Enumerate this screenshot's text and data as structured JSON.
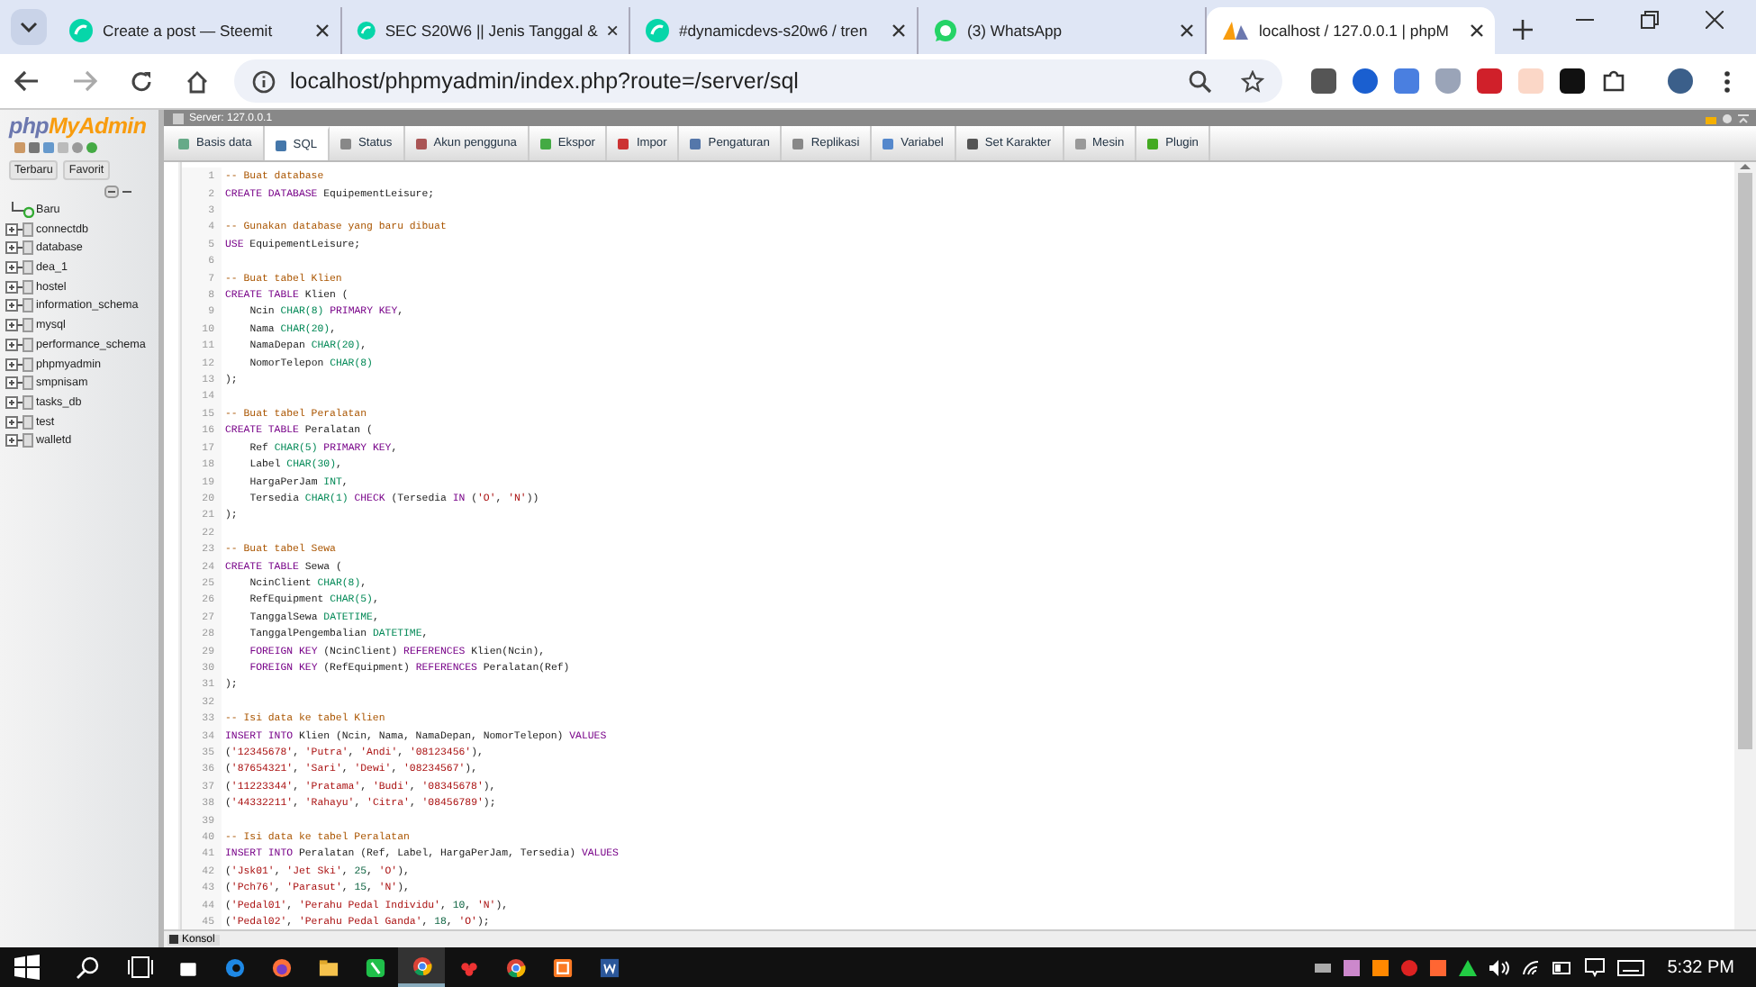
{
  "browser": {
    "tabs": [
      {
        "title": "Create a post — Steemit",
        "selected": false,
        "kind": "steemit"
      },
      {
        "title": "SEC S20W6 || Jenis Tanggal &",
        "selected": false,
        "kind": "steemit"
      },
      {
        "title": "#dynamicdevs-s20w6 / tren",
        "selected": false,
        "kind": "steemit"
      },
      {
        "title": "(3) WhatsApp",
        "selected": false,
        "kind": "whatsapp"
      },
      {
        "title": "localhost / 127.0.0.1 | phpM",
        "selected": true,
        "kind": "pma"
      }
    ],
    "address": "localhost/phpmyadmin/index.php?route=/server/sql"
  },
  "sidebar": {
    "logo": [
      "php",
      "MyAdmin"
    ],
    "buttons": [
      {
        "label": "Terbaru"
      },
      {
        "label": "Favorit"
      }
    ],
    "tree": [
      {
        "name": "Baru",
        "kind": "new"
      },
      {
        "name": "connectdb",
        "kind": "db"
      },
      {
        "name": "database",
        "kind": "db"
      },
      {
        "name": "dea_1",
        "kind": "db"
      },
      {
        "name": "hostel",
        "kind": "db"
      },
      {
        "name": "information_schema",
        "kind": "db"
      },
      {
        "name": "mysql",
        "kind": "db"
      },
      {
        "name": "performance_schema",
        "kind": "db"
      },
      {
        "name": "phpmyadmin",
        "kind": "db"
      },
      {
        "name": "smpnisam",
        "kind": "db"
      },
      {
        "name": "tasks_db",
        "kind": "db"
      },
      {
        "name": "test",
        "kind": "db"
      },
      {
        "name": "walletd",
        "kind": "db"
      }
    ]
  },
  "breadcrumb": "Server: 127.0.0.1",
  "menu": [
    {
      "label": "Basis data",
      "selected": false
    },
    {
      "label": "SQL",
      "selected": true
    },
    {
      "label": "Status",
      "selected": false
    },
    {
      "label": "Akun pengguna",
      "selected": false
    },
    {
      "label": "Ekspor",
      "selected": false
    },
    {
      "label": "Impor",
      "selected": false
    },
    {
      "label": "Pengaturan",
      "selected": false
    },
    {
      "label": "Replikasi",
      "selected": false
    },
    {
      "label": "Variabel",
      "selected": false
    },
    {
      "label": "Set Karakter",
      "selected": false
    },
    {
      "label": "Mesin",
      "selected": false
    },
    {
      "label": "Plugin",
      "selected": false
    }
  ],
  "editor": {
    "lines": [
      {
        "number": "1",
        "segments": [
          {
            "kind": "comment",
            "text": "-- Buat database"
          }
        ]
      },
      {
        "number": "2",
        "segments": [
          {
            "kind": "keyword",
            "text": "CREATE DATABASE"
          },
          {
            "kind": "plain",
            "text": " EquipementLeisure;"
          }
        ]
      },
      {
        "number": "3"
      },
      {
        "number": "4",
        "segments": [
          {
            "kind": "comment",
            "text": "-- Gunakan database yang baru dibuat"
          }
        ]
      },
      {
        "number": "5",
        "segments": [
          {
            "kind": "keyword",
            "text": "USE"
          },
          {
            "kind": "plain",
            "text": " EquipementLeisure;"
          }
        ]
      },
      {
        "number": "6"
      },
      {
        "number": "7",
        "segments": [
          {
            "kind": "comment",
            "text": "-- Buat tabel Klien"
          }
        ]
      },
      {
        "number": "8",
        "segments": [
          {
            "kind": "keyword",
            "text": "CREATE TABLE"
          },
          {
            "kind": "plain",
            "text": " Klien ("
          }
        ]
      },
      {
        "number": "9",
        "indented": true,
        "segments": [
          {
            "kind": "plain",
            "text": "Ncin "
          },
          {
            "kind": "type",
            "text": "CHAR(8)"
          },
          {
            "kind": "keyword",
            "text": " PRIMARY KEY"
          },
          {
            "kind": "plain",
            "text": ","
          }
        ]
      },
      {
        "number": "10",
        "indented": true,
        "segments": [
          {
            "kind": "plain",
            "text": "Nama "
          },
          {
            "kind": "type",
            "text": "CHAR(20)"
          },
          {
            "kind": "plain",
            "text": ","
          }
        ]
      },
      {
        "number": "11",
        "indented": true,
        "segments": [
          {
            "kind": "plain",
            "text": "NamaDepan "
          },
          {
            "kind": "type",
            "text": "CHAR(20)"
          },
          {
            "kind": "plain",
            "text": ","
          }
        ]
      },
      {
        "number": "12",
        "indented": true,
        "segments": [
          {
            "kind": "plain",
            "text": "NomorTelepon "
          },
          {
            "kind": "type",
            "text": "CHAR(8)"
          }
        ]
      },
      {
        "number": "13",
        "segments": [
          {
            "kind": "plain",
            "text": ");"
          }
        ]
      },
      {
        "number": "14"
      },
      {
        "number": "15",
        "segments": [
          {
            "kind": "comment",
            "text": "-- Buat tabel Peralatan"
          }
        ]
      },
      {
        "number": "16",
        "segments": [
          {
            "kind": "keyword",
            "text": "CREATE TABLE"
          },
          {
            "kind": "plain",
            "text": " Peralatan ("
          }
        ]
      },
      {
        "number": "17",
        "indented": true,
        "segments": [
          {
            "kind": "plain",
            "text": "Ref "
          },
          {
            "kind": "type",
            "text": "CHAR(5)"
          },
          {
            "kind": "keyword",
            "text": " PRIMARY KEY"
          },
          {
            "kind": "plain",
            "text": ","
          }
        ]
      },
      {
        "number": "18",
        "indented": true,
        "segments": [
          {
            "kind": "plain",
            "text": "Label "
          },
          {
            "kind": "type",
            "text": "CHAR(30)"
          },
          {
            "kind": "plain",
            "text": ","
          }
        ]
      },
      {
        "number": "19",
        "indented": true,
        "segments": [
          {
            "kind": "plain",
            "text": "HargaPerJam "
          },
          {
            "kind": "type",
            "text": "INT"
          },
          {
            "kind": "plain",
            "text": ","
          }
        ]
      },
      {
        "number": "20",
        "indented": true,
        "segments": [
          {
            "kind": "plain",
            "text": "Tersedia "
          },
          {
            "kind": "type",
            "text": "CHAR(1)"
          },
          {
            "kind": "keyword",
            "text": " CHECK"
          },
          {
            "kind": "plain",
            "text": " (Tersedia "
          },
          {
            "kind": "keyword",
            "text": "IN"
          },
          {
            "kind": "plain",
            "text": " ("
          },
          {
            "kind": "string",
            "text": "'O'"
          },
          {
            "kind": "plain",
            "text": ", "
          },
          {
            "kind": "string",
            "text": "'N'"
          },
          {
            "kind": "plain",
            "text": "))"
          }
        ]
      },
      {
        "number": "21",
        "segments": [
          {
            "kind": "plain",
            "text": ");"
          }
        ]
      },
      {
        "number": "22"
      },
      {
        "number": "23",
        "segments": [
          {
            "kind": "comment",
            "text": "-- Buat tabel Sewa"
          }
        ]
      },
      {
        "number": "24",
        "segments": [
          {
            "kind": "keyword",
            "text": "CREATE TABLE"
          },
          {
            "kind": "plain",
            "text": " Sewa ("
          }
        ]
      },
      {
        "number": "25",
        "indented": true,
        "segments": [
          {
            "kind": "plain",
            "text": "NcinClient "
          },
          {
            "kind": "type",
            "text": "CHAR(8)"
          },
          {
            "kind": "plain",
            "text": ","
          }
        ]
      },
      {
        "number": "26",
        "indented": true,
        "segments": [
          {
            "kind": "plain",
            "text": "RefEquipment "
          },
          {
            "kind": "type",
            "text": "CHAR(5)"
          },
          {
            "kind": "plain",
            "text": ","
          }
        ]
      },
      {
        "number": "27",
        "indented": true,
        "segments": [
          {
            "kind": "plain",
            "text": "TanggalSewa "
          },
          {
            "kind": "type",
            "text": "DATETIME"
          },
          {
            "kind": "plain",
            "text": ","
          }
        ]
      },
      {
        "number": "28",
        "indented": true,
        "segments": [
          {
            "kind": "plain",
            "text": "TanggalPengembalian "
          },
          {
            "kind": "type",
            "text": "DATETIME"
          },
          {
            "kind": "plain",
            "text": ","
          }
        ]
      },
      {
        "number": "29",
        "indented": true,
        "segments": [
          {
            "kind": "keyword",
            "text": "FOREIGN KEY"
          },
          {
            "kind": "plain",
            "text": " (NcinClient) "
          },
          {
            "kind": "keyword",
            "text": "REFERENCES"
          },
          {
            "kind": "plain",
            "text": " Klien(Ncin),"
          }
        ]
      },
      {
        "number": "30",
        "indented": true,
        "segments": [
          {
            "kind": "keyword",
            "text": "FOREIGN KEY"
          },
          {
            "kind": "plain",
            "text": " (RefEquipment) "
          },
          {
            "kind": "keyword",
            "text": "REFERENCES"
          },
          {
            "kind": "plain",
            "text": " Peralatan(Ref)"
          }
        ]
      },
      {
        "number": "31",
        "segments": [
          {
            "kind": "plain",
            "text": ");"
          }
        ]
      },
      {
        "number": "32"
      },
      {
        "number": "33",
        "segments": [
          {
            "kind": "comment",
            "text": "-- Isi data ke tabel Klien"
          }
        ]
      },
      {
        "number": "34",
        "segments": [
          {
            "kind": "keyword",
            "text": "INSERT INTO"
          },
          {
            "kind": "plain",
            "text": " Klien (Ncin, Nama, NamaDepan, NomorTelepon) "
          },
          {
            "kind": "keyword",
            "text": "VALUES"
          }
        ]
      },
      {
        "number": "35",
        "segments": [
          {
            "kind": "plain",
            "text": "("
          },
          {
            "kind": "string",
            "text": "'12345678'"
          },
          {
            "kind": "plain",
            "text": ", "
          },
          {
            "kind": "string",
            "text": "'Putra'"
          },
          {
            "kind": "plain",
            "text": ", "
          },
          {
            "kind": "string",
            "text": "'Andi'"
          },
          {
            "kind": "plain",
            "text": ", "
          },
          {
            "kind": "string",
            "text": "'08123456'"
          },
          {
            "kind": "plain",
            "text": "),"
          }
        ]
      },
      {
        "number": "36",
        "segments": [
          {
            "kind": "plain",
            "text": "("
          },
          {
            "kind": "string",
            "text": "'87654321'"
          },
          {
            "kind": "plain",
            "text": ", "
          },
          {
            "kind": "string",
            "text": "'Sari'"
          },
          {
            "kind": "plain",
            "text": ", "
          },
          {
            "kind": "string",
            "text": "'Dewi'"
          },
          {
            "kind": "plain",
            "text": ", "
          },
          {
            "kind": "string",
            "text": "'08234567'"
          },
          {
            "kind": "plain",
            "text": "),"
          }
        ]
      },
      {
        "number": "37",
        "segments": [
          {
            "kind": "plain",
            "text": "("
          },
          {
            "kind": "string",
            "text": "'11223344'"
          },
          {
            "kind": "plain",
            "text": ", "
          },
          {
            "kind": "string",
            "text": "'Pratama'"
          },
          {
            "kind": "plain",
            "text": ", "
          },
          {
            "kind": "string",
            "text": "'Budi'"
          },
          {
            "kind": "plain",
            "text": ", "
          },
          {
            "kind": "string",
            "text": "'08345678'"
          },
          {
            "kind": "plain",
            "text": "),"
          }
        ]
      },
      {
        "number": "38",
        "segments": [
          {
            "kind": "plain",
            "text": "("
          },
          {
            "kind": "string",
            "text": "'44332211'"
          },
          {
            "kind": "plain",
            "text": ", "
          },
          {
            "kind": "string",
            "text": "'Rahayu'"
          },
          {
            "kind": "plain",
            "text": ", "
          },
          {
            "kind": "string",
            "text": "'Citra'"
          },
          {
            "kind": "plain",
            "text": ", "
          },
          {
            "kind": "string",
            "text": "'08456789'"
          },
          {
            "kind": "plain",
            "text": ");"
          }
        ]
      },
      {
        "number": "39"
      },
      {
        "number": "40",
        "segments": [
          {
            "kind": "comment",
            "text": "-- Isi data ke tabel Peralatan"
          }
        ]
      },
      {
        "number": "41",
        "segments": [
          {
            "kind": "keyword",
            "text": "INSERT INTO"
          },
          {
            "kind": "plain",
            "text": " Peralatan (Ref, Label, HargaPerJam, Tersedia) "
          },
          {
            "kind": "keyword",
            "text": "VALUES"
          }
        ]
      },
      {
        "number": "42",
        "segments": [
          {
            "kind": "plain",
            "text": "("
          },
          {
            "kind": "string",
            "text": "'Jsk01'"
          },
          {
            "kind": "plain",
            "text": ", "
          },
          {
            "kind": "string",
            "text": "'Jet Ski'"
          },
          {
            "kind": "plain",
            "text": ", "
          },
          {
            "kind": "number",
            "text": "25"
          },
          {
            "kind": "plain",
            "text": ", "
          },
          {
            "kind": "string",
            "text": "'O'"
          },
          {
            "kind": "plain",
            "text": "),"
          }
        ]
      },
      {
        "number": "43",
        "segments": [
          {
            "kind": "plain",
            "text": "("
          },
          {
            "kind": "string",
            "text": "'Pch76'"
          },
          {
            "kind": "plain",
            "text": ", "
          },
          {
            "kind": "string",
            "text": "'Parasut'"
          },
          {
            "kind": "plain",
            "text": ", "
          },
          {
            "kind": "number",
            "text": "15"
          },
          {
            "kind": "plain",
            "text": ", "
          },
          {
            "kind": "string",
            "text": "'N'"
          },
          {
            "kind": "plain",
            "text": "),"
          }
        ]
      },
      {
        "number": "44",
        "segments": [
          {
            "kind": "plain",
            "text": "("
          },
          {
            "kind": "string",
            "text": "'Pedal01'"
          },
          {
            "kind": "plain",
            "text": ", "
          },
          {
            "kind": "string",
            "text": "'Perahu Pedal Individu'"
          },
          {
            "kind": "plain",
            "text": ", "
          },
          {
            "kind": "number",
            "text": "10"
          },
          {
            "kind": "plain",
            "text": ", "
          },
          {
            "kind": "string",
            "text": "'N'"
          },
          {
            "kind": "plain",
            "text": "),"
          }
        ]
      },
      {
        "number": "45",
        "segments": [
          {
            "kind": "plain",
            "text": "("
          },
          {
            "kind": "string",
            "text": "'Pedal02'"
          },
          {
            "kind": "plain",
            "text": ", "
          },
          {
            "kind": "string",
            "text": "'Perahu Pedal Ganda'"
          },
          {
            "kind": "plain",
            "text": ", "
          },
          {
            "kind": "number",
            "text": "18"
          },
          {
            "kind": "plain",
            "text": ", "
          },
          {
            "kind": "string",
            "text": "'O'"
          },
          {
            "kind": "plain",
            "text": ");"
          }
        ]
      }
    ]
  },
  "console": "Konsol",
  "taskbar": {
    "apps": [
      {
        "kind": "store",
        "selected": false
      },
      {
        "kind": "edge",
        "selected": false
      },
      {
        "kind": "firefox",
        "selected": false
      },
      {
        "kind": "folder",
        "selected": false
      },
      {
        "kind": "green",
        "selected": false
      },
      {
        "kind": "chrome",
        "selected": true
      },
      {
        "kind": "red",
        "selected": false
      },
      {
        "kind": "chrome",
        "selected": false
      },
      {
        "kind": "orange",
        "selected": false
      },
      {
        "kind": "word",
        "selected": false
      }
    ],
    "time": "5:32 PM"
  }
}
